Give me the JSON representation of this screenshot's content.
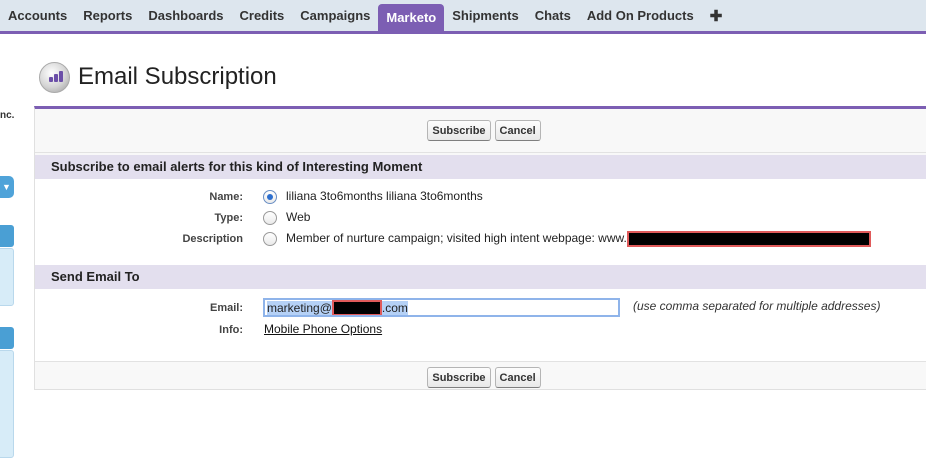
{
  "tabs": [
    {
      "label": "Accounts"
    },
    {
      "label": "Reports"
    },
    {
      "label": "Dashboards"
    },
    {
      "label": "Credits"
    },
    {
      "label": "Campaigns"
    },
    {
      "label": "Marketo",
      "active": true
    },
    {
      "label": "Shipments"
    },
    {
      "label": "Chats"
    },
    {
      "label": "Add On Products"
    }
  ],
  "add_tab_label": "✚",
  "sidebar": {
    "fragment_text": "nc."
  },
  "page": {
    "title": "Email Subscription",
    "icon": "marketo-logo-icon"
  },
  "buttons": {
    "subscribe": "Subscribe",
    "cancel": "Cancel"
  },
  "interesting_moment": {
    "heading": "Subscribe to email alerts for this kind of Interesting Moment",
    "name_label": "Name:",
    "name_value": "liliana 3to6months liliana 3to6months",
    "name_selected": true,
    "type_label": "Type:",
    "type_value": "Web",
    "description_label": "Description",
    "description_value": "Member of nurture campaign; visited high intent webpage: www."
  },
  "send_email": {
    "heading": "Send Email To",
    "email_label": "Email:",
    "email_prefix": "marketing@",
    "email_suffix": ".com",
    "email_hint": "(use comma separated for multiple addresses)",
    "info_label": "Info:",
    "info_link": "Mobile Phone Options"
  },
  "colors": {
    "accent": "#7c5eb3",
    "section_bg": "#e3dfee",
    "tabbar_bg": "#dde6ee",
    "redaction_border": "#e05a5a"
  }
}
